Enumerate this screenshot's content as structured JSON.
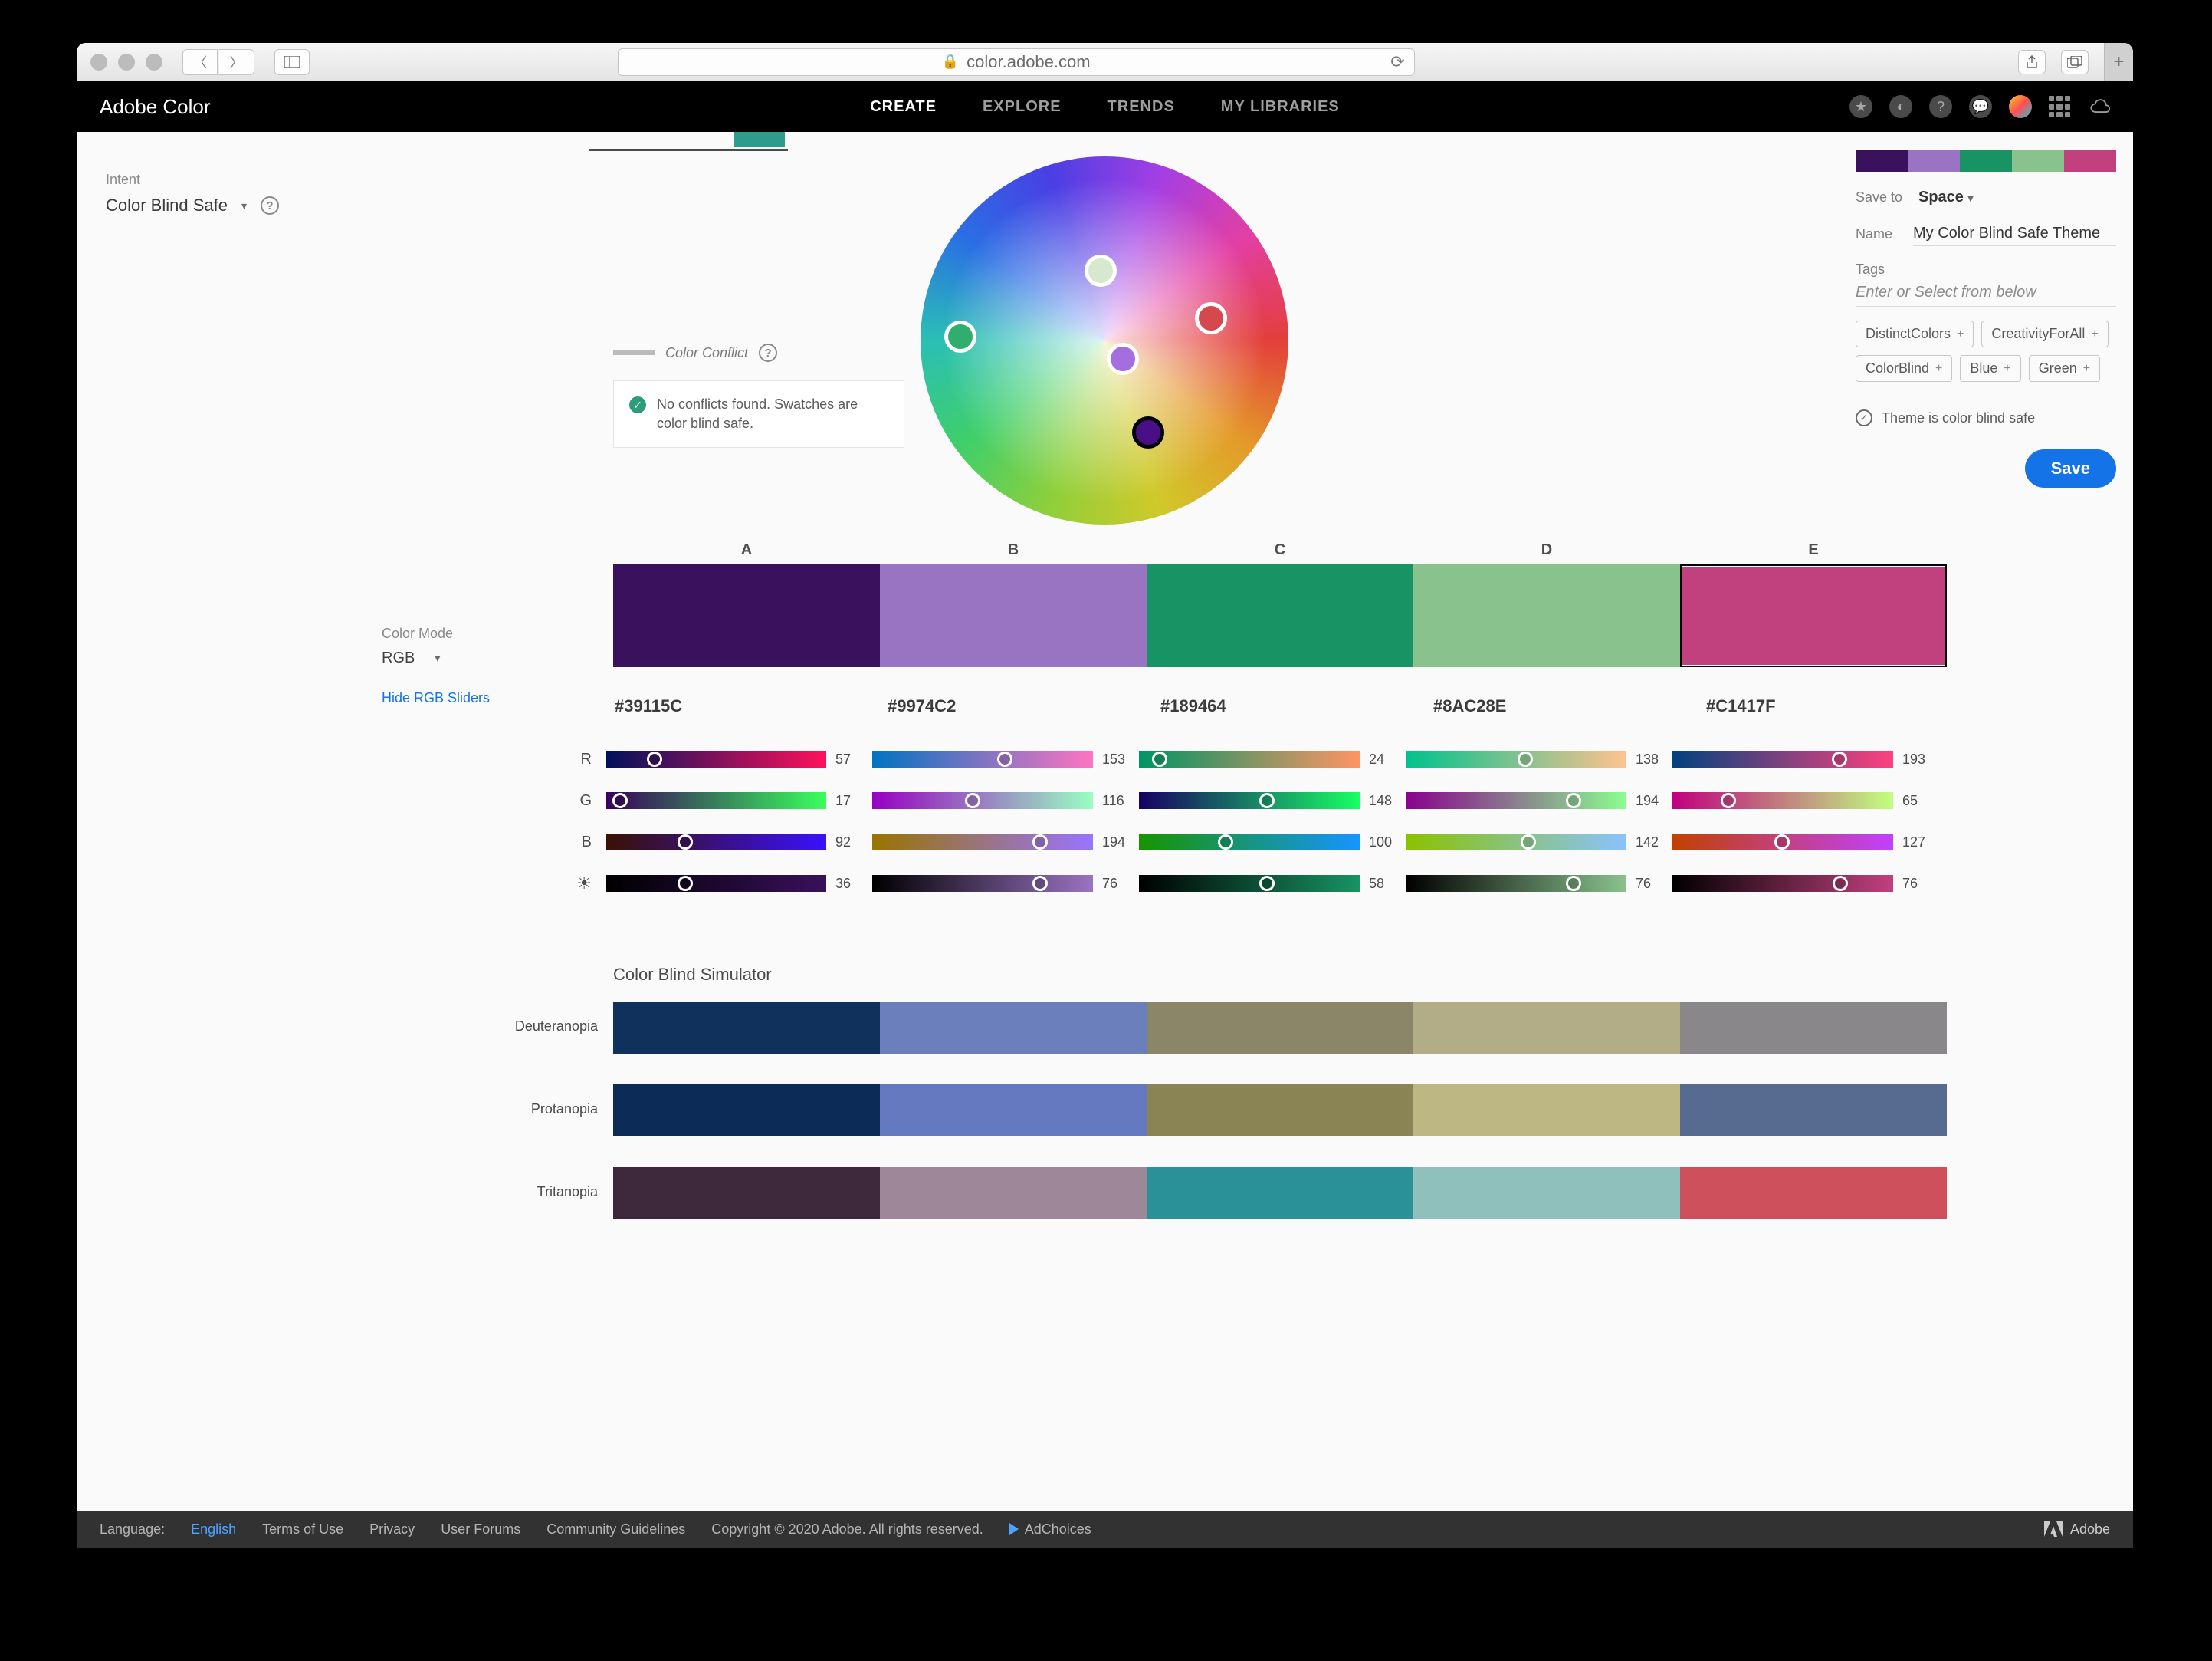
{
  "browser": {
    "url_host": "color.adobe.com"
  },
  "brand": "Adobe Color",
  "nav": {
    "create": "CREATE",
    "explore": "EXPLORE",
    "trends": "TRENDS",
    "libs": "MY LIBRARIES"
  },
  "left": {
    "intent_label": "Intent",
    "intent_value": "Color Blind Safe",
    "legend_label": "Color Conflict",
    "safe_msg": "No conflicts found. Swatches are color blind safe.",
    "mode_label": "Color Mode",
    "mode_value": "RGB",
    "hide_link": "Hide RGB Sliders"
  },
  "swatches": [
    {
      "label": "A",
      "hex": "#39115C",
      "rgb": {
        "r": 57,
        "g": 17,
        "b": 92
      },
      "bright": 36
    },
    {
      "label": "B",
      "hex": "#9974C2",
      "rgb": {
        "r": 153,
        "g": 116,
        "b": 194
      },
      "bright": 76
    },
    {
      "label": "C",
      "hex": "#189464",
      "rgb": {
        "r": 24,
        "g": 148,
        "b": 100
      },
      "bright": 58
    },
    {
      "label": "D",
      "hex": "#8AC28E",
      "rgb": {
        "r": 138,
        "g": 194,
        "b": 142
      },
      "bright": 76
    },
    {
      "label": "E",
      "hex": "#C1417F",
      "rgb": {
        "r": 193,
        "g": 65,
        "b": 127
      },
      "bright": 76
    }
  ],
  "slider_labels": {
    "r": "R",
    "g": "G",
    "b": "B"
  },
  "selected_index": 4,
  "sim": {
    "title": "Color Blind Simulator",
    "rows": [
      {
        "label": "Deuteranopia",
        "colors": [
          "#10315c",
          "#6b7fbd",
          "#8b8667",
          "#b3ad87",
          "#89878a"
        ]
      },
      {
        "label": "Protanopia",
        "colors": [
          "#0d2b57",
          "#6579c0",
          "#8a8353",
          "#bdb784",
          "#576a8f"
        ]
      },
      {
        "label": "Tritanopia",
        "colors": [
          "#3e283c",
          "#9e8799",
          "#2b9198",
          "#90c0bb",
          "#cd505c"
        ]
      }
    ]
  },
  "right": {
    "saveto_label": "Save to",
    "saveto_value": "Space",
    "name_label": "Name",
    "name_value": "My Color Blind Safe Theme",
    "tags_label": "Tags",
    "tags_placeholder": "Enter or Select from below",
    "tags": [
      "DistinctColors",
      "CreativityForAll",
      "ColorBlind",
      "Blue",
      "Green"
    ],
    "safe_status": "Theme is color blind safe",
    "save_btn": "Save"
  },
  "footer": {
    "lang_lbl": "Language:",
    "lang_val": "English",
    "terms": "Terms of Use",
    "privacy": "Privacy",
    "forums": "User Forums",
    "guidelines": "Community Guidelines",
    "copyright": "Copyright © 2020 Adobe. All rights reserved.",
    "adchoices": "AdChoices",
    "adobe": "Adobe"
  }
}
